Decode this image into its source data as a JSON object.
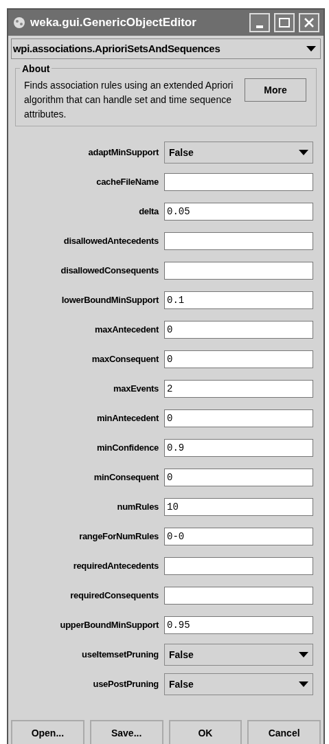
{
  "window": {
    "title": "weka.gui.GenericObjectEditor"
  },
  "class_selector": {
    "value": "wpi.associations.AprioriSetsAndSequences"
  },
  "about": {
    "title": "About",
    "text": "Finds association rules using an extended Apriori algorithm that can handle set and time sequence attributes.",
    "button": "More"
  },
  "properties": [
    {
      "label": "adaptMinSupport",
      "kind": "combo",
      "value": "False"
    },
    {
      "label": "cacheFileName",
      "kind": "text"
    },
    {
      "label": "delta",
      "kind": "text",
      "value": "0.05"
    },
    {
      "label": "disallowedAntecedents",
      "kind": "text"
    },
    {
      "label": "disallowedConsequents",
      "kind": "text"
    },
    {
      "label": "lowerBoundMinSupport",
      "kind": "text",
      "value": "0.1"
    },
    {
      "label": "maxAntecedent",
      "kind": "text",
      "value": "0"
    },
    {
      "label": "maxConsequent",
      "kind": "text",
      "value": "0"
    },
    {
      "label": "maxEvents",
      "kind": "text",
      "value": "2"
    },
    {
      "label": "minAntecedent",
      "kind": "text",
      "value": "0"
    },
    {
      "label": "minConfidence",
      "kind": "text",
      "value": "0.9"
    },
    {
      "label": "minConsequent",
      "kind": "text",
      "value": "0"
    },
    {
      "label": "numRules",
      "kind": "text",
      "value": "10"
    },
    {
      "label": "rangeForNumRules",
      "kind": "text",
      "value": "0-0"
    },
    {
      "label": "requiredAntecedents",
      "kind": "text"
    },
    {
      "label": "requiredConsequents",
      "kind": "text"
    },
    {
      "label": "upperBoundMinSupport",
      "kind": "text",
      "value": "0.95"
    },
    {
      "label": "useItemsetPruning",
      "kind": "combo",
      "value": "False"
    },
    {
      "label": "usePostPruning",
      "kind": "combo",
      "value": "False"
    }
  ],
  "buttons": [
    "Open...",
    "Save...",
    "OK",
    "Cancel"
  ]
}
